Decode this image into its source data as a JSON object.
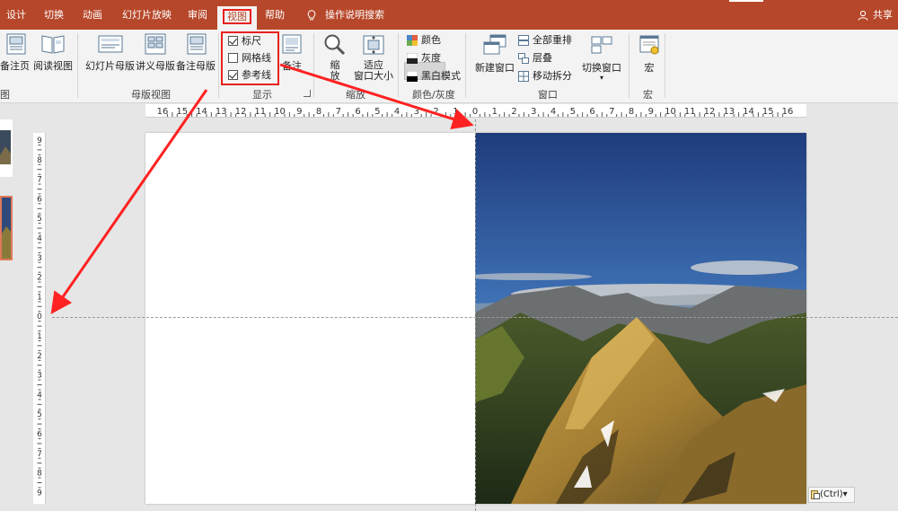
{
  "tabs": [
    {
      "id": "design",
      "label": "设计"
    },
    {
      "id": "transitions",
      "label": "切换"
    },
    {
      "id": "animations",
      "label": "动画"
    },
    {
      "id": "slideshow",
      "label": "幻灯片放映"
    },
    {
      "id": "review",
      "label": "审阅"
    },
    {
      "id": "view",
      "label": "视图"
    },
    {
      "id": "help",
      "label": "帮助"
    }
  ],
  "tell_me": "操作说明搜索",
  "share": "共享",
  "ribbon": {
    "views": {
      "notes_page": "备注页",
      "reading_view": "阅读视图"
    },
    "master_views": {
      "slide_master": "幻灯片母版",
      "handout_master": "讲义母版",
      "notes_master": "备注母版",
      "label": "母版视图"
    },
    "show": {
      "ruler": "标尺",
      "gridlines": "网格线",
      "guides": "参考线",
      "notes": "备注",
      "label": "显示",
      "ruler_checked": true,
      "gridlines_checked": false,
      "guides_checked": true
    },
    "zoom": {
      "zoom_line1": "缩",
      "zoom_line2": "放",
      "fit_line1": "适应",
      "fit_line2": "窗口大小",
      "label": "缩放"
    },
    "color": {
      "color": "颜色",
      "grayscale": "灰度",
      "bw": "黑白模式",
      "label": "颜色/灰度"
    },
    "window": {
      "new_window": "新建窗口",
      "arrange_all": "全部重排",
      "cascade": "层叠",
      "move_split": "移动拆分",
      "switch_windows": "切换窗口",
      "label": "窗口"
    },
    "macros": {
      "macros": "宏",
      "label": "宏"
    }
  },
  "hruler_labels": [
    "16",
    "15",
    "14",
    "13",
    "12",
    "11",
    "10",
    "9",
    "8",
    "7",
    "6",
    "5",
    "4",
    "3",
    "2",
    "1",
    "0",
    "1",
    "2",
    "3",
    "4",
    "5",
    "6",
    "7",
    "8",
    "9",
    "10",
    "11",
    "12",
    "13",
    "14",
    "15",
    "16"
  ],
  "vruler_labels": [
    "9",
    "8",
    "7",
    "6",
    "5",
    "4",
    "3",
    "2",
    "1",
    "0",
    "1",
    "2",
    "3",
    "4",
    "5",
    "6",
    "7",
    "8",
    "9"
  ],
  "paste_options": "(Ctrl)",
  "colors": {
    "accent": "#b7472a",
    "highlight": "#e8211d"
  }
}
